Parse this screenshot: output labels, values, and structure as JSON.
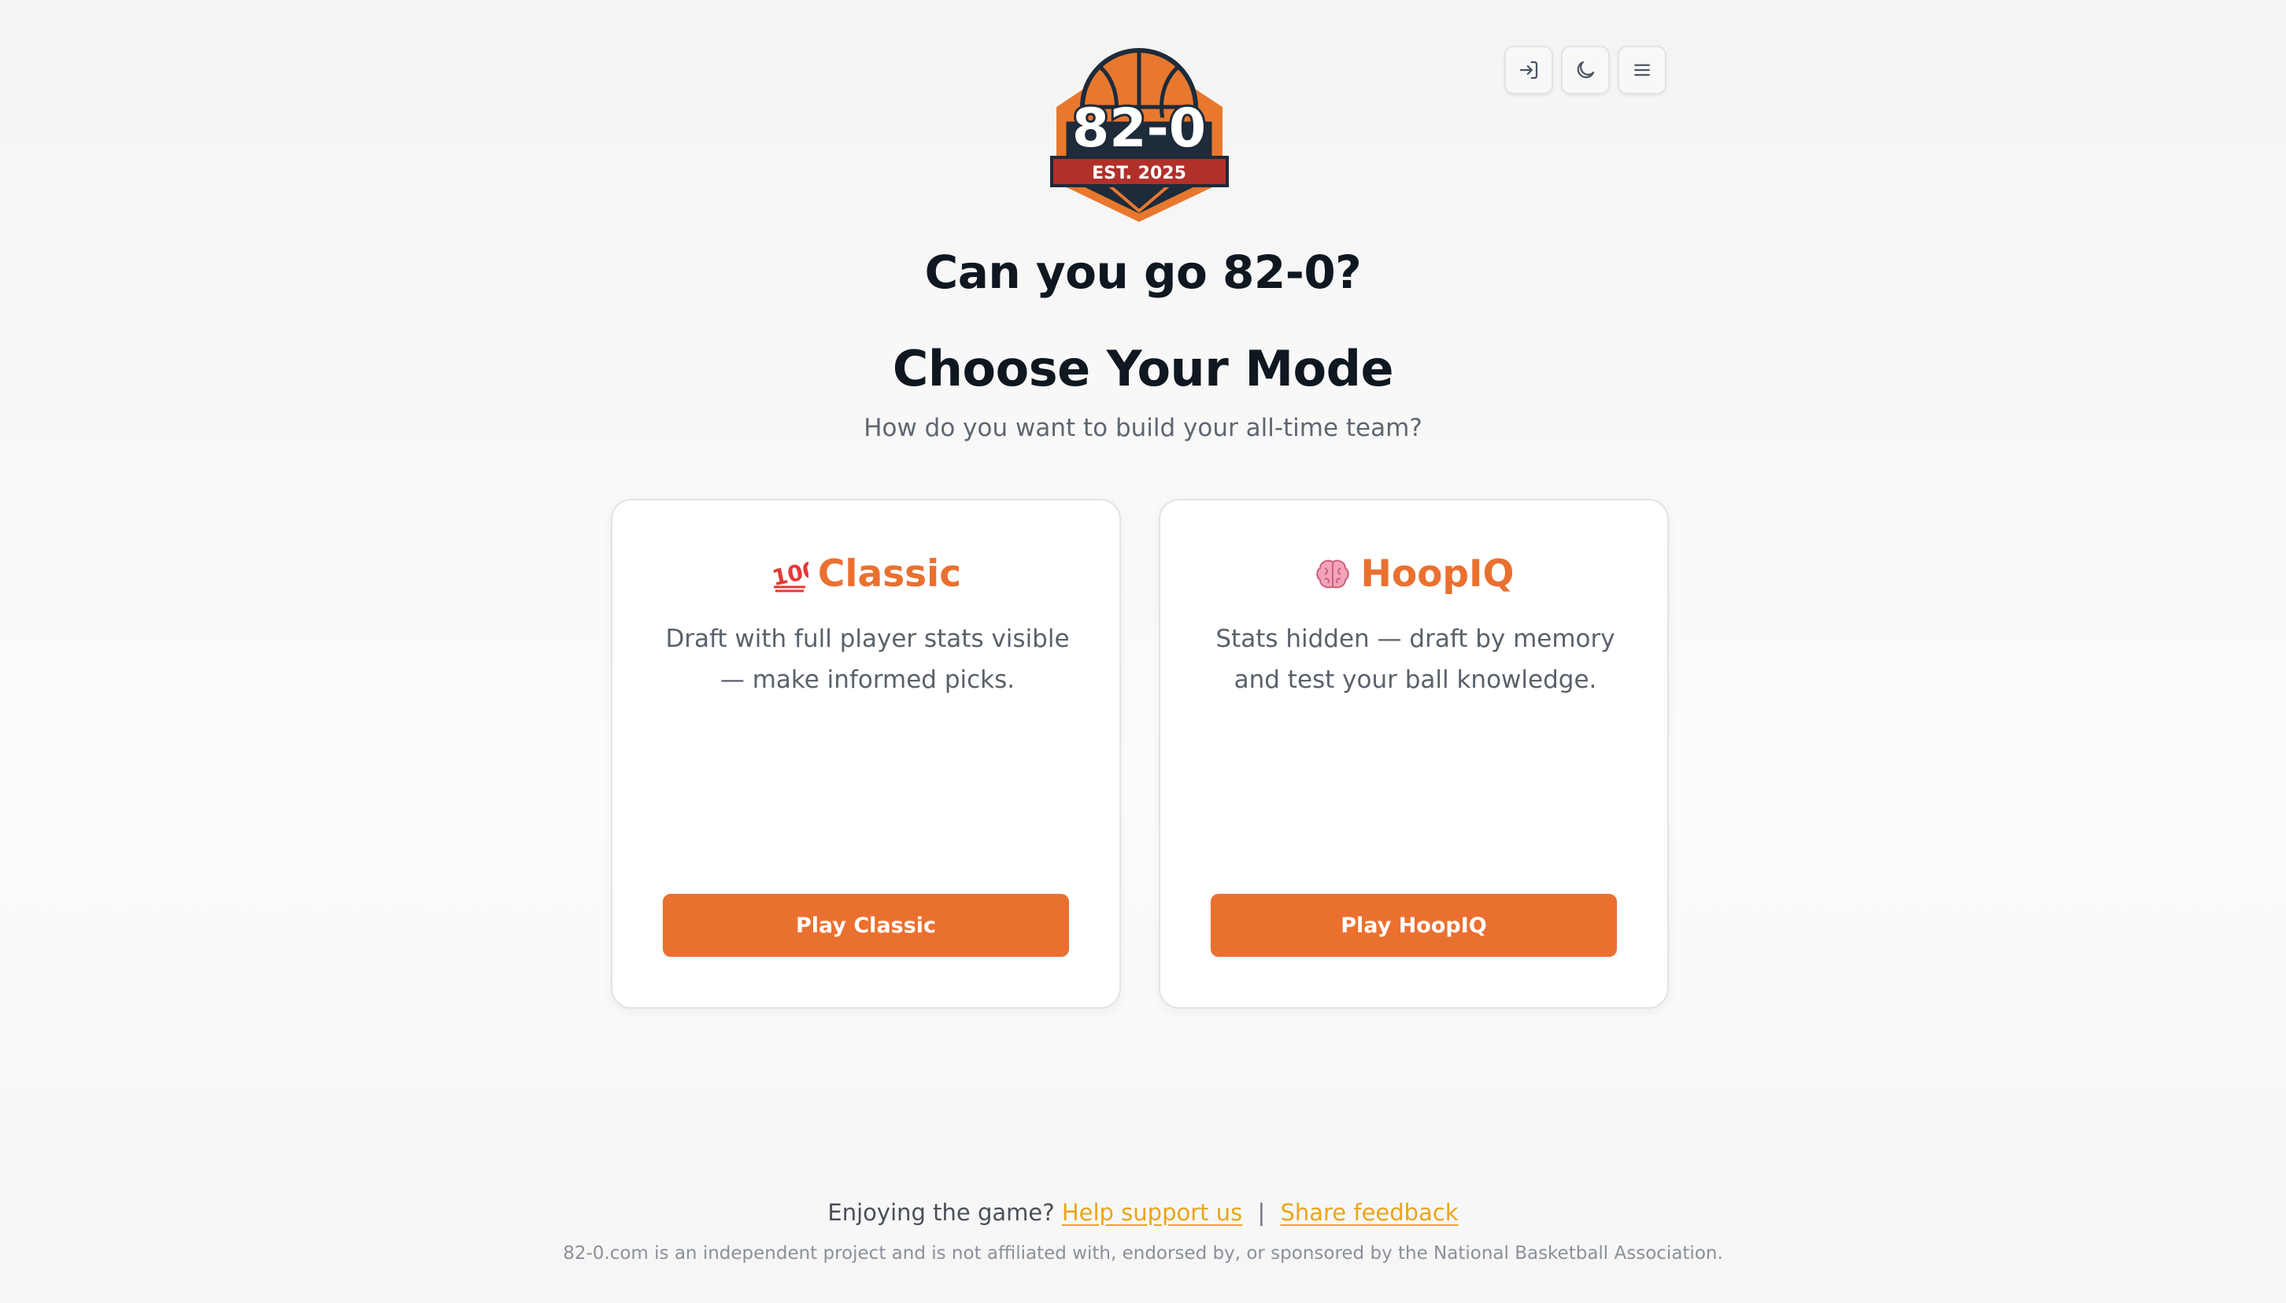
{
  "header": {
    "icons": {
      "login": "login-icon",
      "theme": "moon-icon",
      "menu": "menu-icon"
    }
  },
  "logo": {
    "main_text": "82-0",
    "banner_text": "EST. 2025",
    "colors": {
      "ball": "#e8782e",
      "shield": "#1d2b3a",
      "banner": "#b2302a"
    }
  },
  "hero": {
    "tagline": "Can you go 82-0?",
    "title": "Choose Your Mode",
    "subtitle": "How do you want to build your all-time team?"
  },
  "modes": [
    {
      "icon": "hundred-points-icon",
      "title": "Classic",
      "description": "Draft with full player stats visible — make informed picks.",
      "button_label": "Play Classic"
    },
    {
      "icon": "brain-icon",
      "title": "HoopIQ",
      "description": "Stats hidden — draft by memory and test your ball knowledge.",
      "button_label": "Play HoopIQ"
    }
  ],
  "footer": {
    "prompt": "Enjoying the game?",
    "support_link": "Help support us",
    "separator": "|",
    "feedback_link": "Share feedback",
    "disclaimer": "82-0.com is an independent project and is not affiliated with, endorsed by, or sponsored by the National Basketball Association."
  },
  "theme": {
    "accent": "#ea7030",
    "link": "#eaa51b"
  }
}
